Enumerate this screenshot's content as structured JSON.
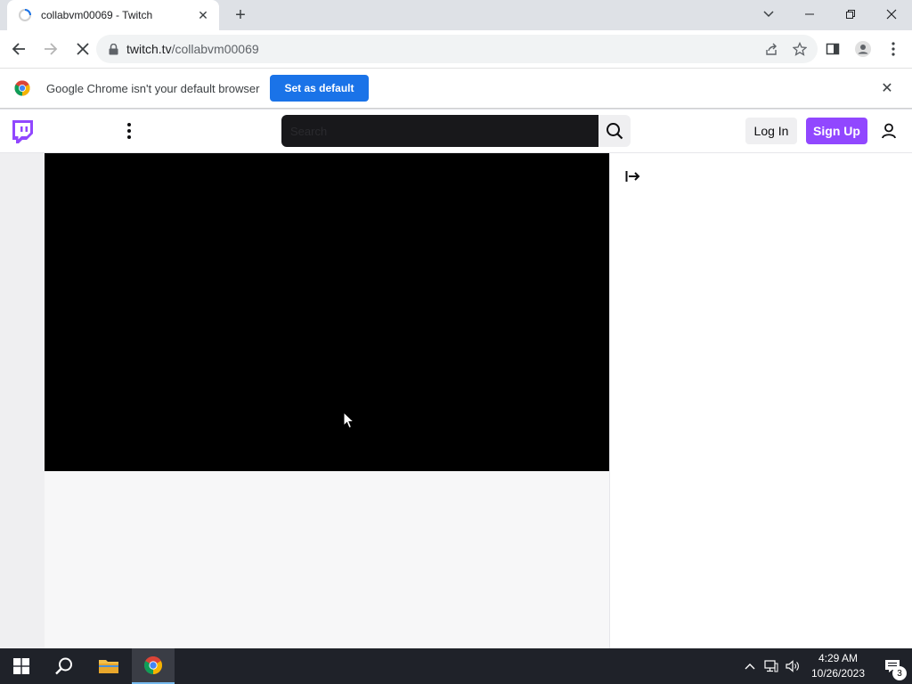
{
  "browser": {
    "tab": {
      "title": "collabvm00069 - Twitch"
    },
    "url": {
      "host": "twitch.tv",
      "path": "/collabvm00069"
    }
  },
  "infobar": {
    "message": "Google Chrome isn't your default browser",
    "button_label": "Set as default"
  },
  "twitch": {
    "search_placeholder": "Search",
    "login_label": "Log In",
    "signup_label": "Sign Up",
    "brand_color": "#9147ff"
  },
  "taskbar": {
    "time": "4:29 AM",
    "date": "10/26/2023",
    "notification_count": "3"
  }
}
